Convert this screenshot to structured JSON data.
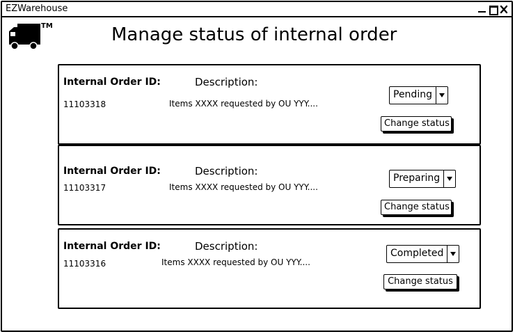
{
  "window": {
    "title": "EZWarehouse",
    "controls": {
      "minimize_icon": "minimize-icon",
      "maximize_icon": "maximize-icon",
      "close_icon": "close-icon"
    }
  },
  "logo": {
    "icon": "truck-icon",
    "mark": "TM"
  },
  "page": {
    "title": "Manage status of internal order"
  },
  "labels": {
    "order_id": "Internal Order ID:",
    "description": "Description:",
    "change_status": "Change status"
  },
  "orders": [
    {
      "id": "11103318",
      "description": "Items XXXX requested by OU YYY....",
      "status": "Pending"
    },
    {
      "id": "11103317",
      "description": "Items XXXX requested by OU YYY....",
      "status": "Preparing"
    },
    {
      "id": "11103316",
      "description": "Items XXXX requested by OU YYY....",
      "status": "Completed"
    }
  ]
}
